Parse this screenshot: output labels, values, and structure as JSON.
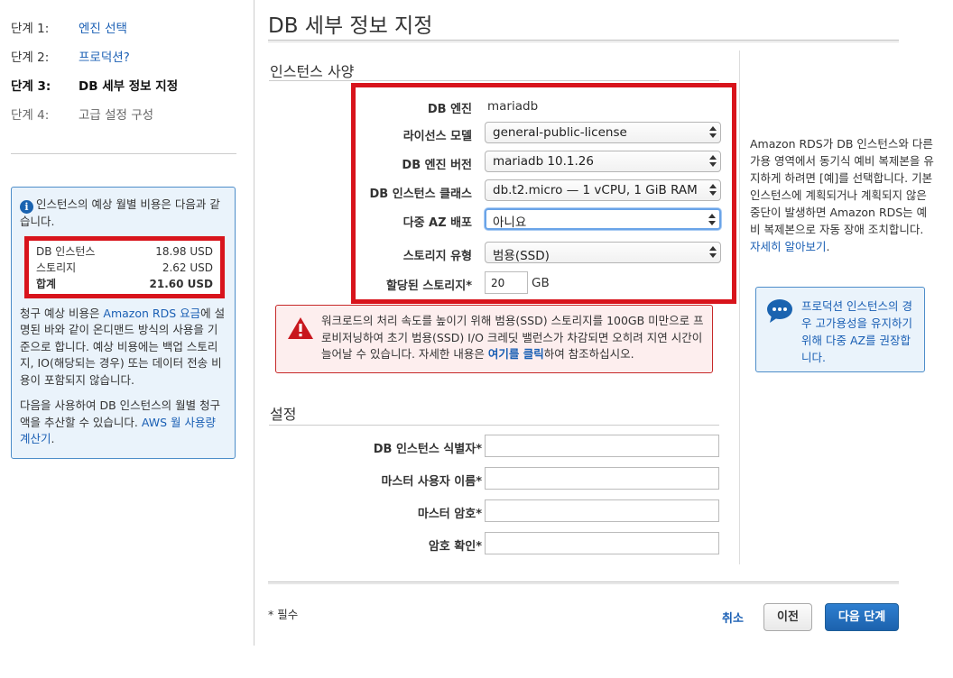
{
  "steps": [
    {
      "num": "단계 1:",
      "label": "엔진 선택"
    },
    {
      "num": "단계 2:",
      "label": "프로덕션?"
    },
    {
      "num": "단계 3:",
      "label": "DB 세부 정보 지정"
    },
    {
      "num": "단계 4:",
      "label": "고급 설정 구성"
    }
  ],
  "cost": {
    "intro": "인스턴스의 예상 월별 비용은 다음과 같습니다.",
    "rows": [
      {
        "label": "DB 인스턴스",
        "value": "18.98 USD"
      },
      {
        "label": "스토리지",
        "value": "2.62 USD"
      },
      {
        "label": "합계",
        "value": "21.60 USD"
      }
    ],
    "note1_pre": "청구 예상 비용은 ",
    "note1_link": "Amazon RDS 요금",
    "note1_post": "에 설명된 바와 같이 온디맨드 방식의 사용을 기준으로 합니다. 예상 비용에는 백업 스토리지, IO(해당되는 경우) 또는 데이터 전송 비용이 포함되지 않습니다.",
    "note2_pre": "다음을 사용하여 DB 인스턴스의 월별 청구액을 추산할 수 있습니다. ",
    "note2_link": "AWS 월 사용량 계산기",
    "note2_post": "."
  },
  "page_title": "DB 세부 정보 지정",
  "spec": {
    "section_title": "인스턴스 사양",
    "engine_label": "DB 엔진",
    "engine_value": "mariadb",
    "license_label": "라이선스 모델",
    "license_value": "general-public-license",
    "version_label": "DB 엔진 버전",
    "version_value": "mariadb 10.1.26",
    "class_label": "DB 인스턴스 클래스",
    "class_value": "db.t2.micro — 1 vCPU, 1 GiB RAM",
    "multiaz_label": "다중 AZ 배포",
    "multiaz_value": "아니요",
    "storage_type_label": "스토리지 유형",
    "storage_type_value": "범용(SSD)",
    "storage_label": "할당된 스토리지*",
    "storage_value": "20",
    "storage_unit": "GB"
  },
  "warning": {
    "text_pre": "워크로드의 처리 속도를 높이기 위해 범용(SSD) 스토리지를 100GB 미만으로 프로비저닝하여 초기 범용(SSD) I/O 크레딧 밸런스가 차감되면 오히려 지연 시간이 늘어날 수 있습니다. 자세한 내용은 ",
    "link": "여기를 클릭",
    "text_post": "하여 참조하십시오."
  },
  "settings": {
    "section_title": "설정",
    "identifier_label": "DB 인스턴스 식별자*",
    "username_label": "마스터 사용자 이름*",
    "password_label": "마스터 암호*",
    "confirm_label": "암호 확인*"
  },
  "footer": {
    "required_note": "* 필수",
    "cancel": "취소",
    "prev": "이전",
    "next": "다음 단계"
  },
  "help": {
    "text": "Amazon RDS가 DB 인스턴스와 다른 가용 영역에서 동기식 예비 복제본을 유지하게 하려면 [예]를 선택합니다. 기본 인스턴스에 계획되거나 계획되지 않은 중단이 발생하면 Amazon RDS는 예비 복제본으로 자동 장애 조치합니다. ",
    "link": "자세히 알아보기",
    "tail": ".",
    "tip": "프로덕션 인스턴스의 경우 고가용성을 유지하기 위해 다중 AZ를 권장합니다."
  },
  "colors": {
    "accent_red": "#d8141c",
    "link_blue": "#1a5fb4",
    "primary_button": "#1c62ad",
    "info_box_bg": "#eaf3fb"
  }
}
